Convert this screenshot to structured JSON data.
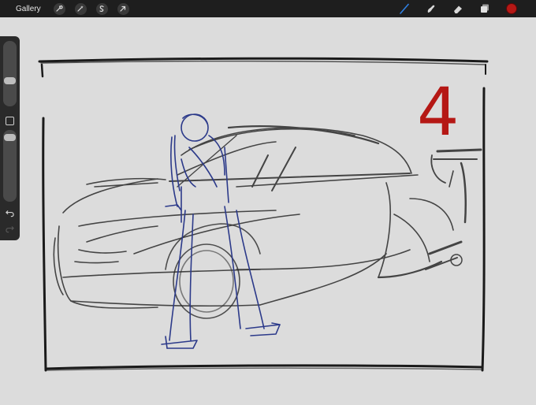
{
  "topbar": {
    "gallery_label": "Gallery",
    "left_tools": [
      {
        "name": "actions",
        "icon": "wrench-icon"
      },
      {
        "name": "adjustments",
        "icon": "magic-wand-icon"
      },
      {
        "name": "selection",
        "icon": "selection-s-icon"
      },
      {
        "name": "transform",
        "icon": "arrow-cursor-icon"
      }
    ],
    "right_tools": [
      {
        "name": "brush",
        "icon": "brush-icon",
        "active": true
      },
      {
        "name": "smudge",
        "icon": "smudge-icon"
      },
      {
        "name": "eraser",
        "icon": "eraser-icon"
      },
      {
        "name": "layers",
        "icon": "layers-icon"
      }
    ],
    "current_color": "#b51815"
  },
  "sidebar": {
    "brush_size_level": 0.6,
    "opacity_level": 0.05,
    "modify_icon": "square-icon",
    "undo_icon": "undo-icon",
    "redo_icon": "redo-icon"
  },
  "canvas": {
    "panel_number": "4",
    "background_color": "#dcdcdc",
    "sketch_colors": {
      "black": "#1a1a1a",
      "blue": "#2c3a8a",
      "red": "#b51815"
    }
  }
}
